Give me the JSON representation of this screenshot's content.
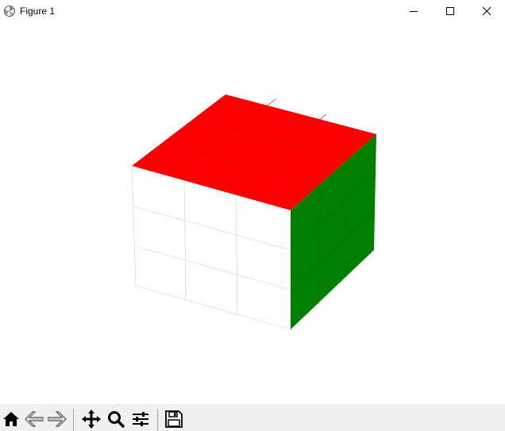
{
  "window": {
    "title": "Figure 1"
  },
  "figure": {
    "faces": {
      "top": {
        "color": "#ff0000",
        "grid": [
          3,
          3
        ]
      },
      "front": {
        "color": "#ffffff",
        "grid": [
          3,
          3
        ]
      },
      "right": {
        "color": "#008000",
        "grid": [
          3,
          3
        ]
      }
    }
  },
  "toolbar": {
    "buttons": [
      {
        "name": "home-button",
        "icon": "home-icon"
      },
      {
        "name": "back-button",
        "icon": "back-arrow-icon"
      },
      {
        "name": "forward-button",
        "icon": "forward-arrow-icon"
      },
      {
        "name": "pan-button",
        "icon": "move-icon"
      },
      {
        "name": "zoom-button",
        "icon": "magnifier-icon"
      },
      {
        "name": "configure-subplots-button",
        "icon": "sliders-icon"
      },
      {
        "name": "save-button",
        "icon": "floppy-disk-icon"
      }
    ]
  }
}
